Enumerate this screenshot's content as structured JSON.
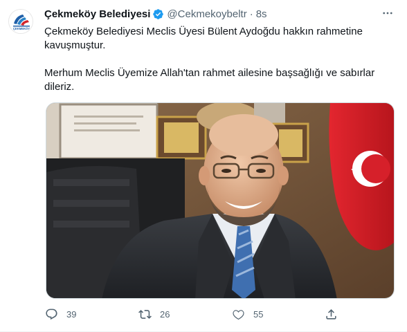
{
  "tweet": {
    "author_name": "Çekmeköy Belediyesi",
    "author_handle": "@Cekmekoybeltr",
    "separator": "·",
    "time": "8s",
    "avatar_text": "ÇEKMEKÖY",
    "text_line1": "Çekmeköy Belediyesi Meclis Üyesi Bülent Aydoğdu hakkın rahmetine kavuşmuştur.",
    "text_line2": "Merhum Meclis Üyemize Allah'tan rahmet ailesine başsağlığı ve sabırlar dileriz."
  },
  "actions": {
    "reply_count": "39",
    "retweet_count": "26",
    "like_count": "55"
  },
  "colors": {
    "text": "#0f1419",
    "secondary": "#536471",
    "verified": "#1d9bf0",
    "brand_blue": "#1f5fa8",
    "brand_red": "#d2232a"
  },
  "icons": [
    "verified-badge-icon",
    "more-icon",
    "reply-icon",
    "retweet-icon",
    "like-icon",
    "share-icon"
  ]
}
